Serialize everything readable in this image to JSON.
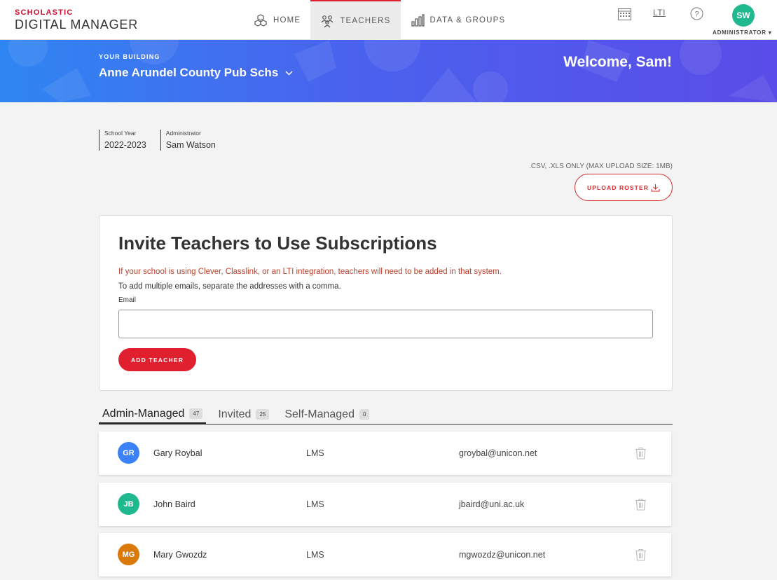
{
  "brand": {
    "top": "SCHOLASTIC",
    "bottom": "DIGITAL MANAGER"
  },
  "nav": [
    {
      "label": "HOME",
      "icon": "cubes-icon",
      "active": false
    },
    {
      "label": "TEACHERS",
      "icon": "teachers-icon",
      "active": true
    },
    {
      "label": "DATA & GROUPS",
      "icon": "bar-chart-icon",
      "active": false
    }
  ],
  "header_right": {
    "lti": "LTI",
    "avatar_initials": "SW",
    "role": "ADMINISTRATOR ▾"
  },
  "hero": {
    "building_label": "YOUR BUILDING",
    "building_name": "Anne Arundel County Pub Schs",
    "welcome": "Welcome, Sam!"
  },
  "meta": {
    "school_year_label": "School Year",
    "school_year": "2022-2023",
    "admin_label": "Administrator",
    "admin_name": "Sam Watson"
  },
  "upload": {
    "note": ".CSV, .XLS ONLY (MAX UPLOAD SIZE: 1MB)",
    "button": "UPLOAD ROSTER"
  },
  "invite": {
    "title": "Invite Teachers to Use Subscriptions",
    "warning": "If your school is using Clever, Classlink, or an LTI integration, teachers will need to be added in that system.",
    "hint": "To add multiple emails, separate the addresses with a comma.",
    "email_label": "Email",
    "email_value": "",
    "add_button": "ADD TEACHER"
  },
  "tabs": [
    {
      "label": "Admin-Managed",
      "count": "47"
    },
    {
      "label": "Invited",
      "count": "25"
    },
    {
      "label": "Self-Managed",
      "count": "0"
    }
  ],
  "teachers": [
    {
      "initials": "GR",
      "name": "Gary Roybal",
      "type": "LMS",
      "email": "groybal@unicon.net",
      "color": "#3b82f6"
    },
    {
      "initials": "JB",
      "name": "John Baird",
      "type": "LMS",
      "email": "jbaird@uni.ac.uk",
      "color": "#1fb88f"
    },
    {
      "initials": "MG",
      "name": "Mary Gwozdz",
      "type": "LMS",
      "email": "mgwozdz@unicon.net",
      "color": "#d97a0a"
    }
  ]
}
